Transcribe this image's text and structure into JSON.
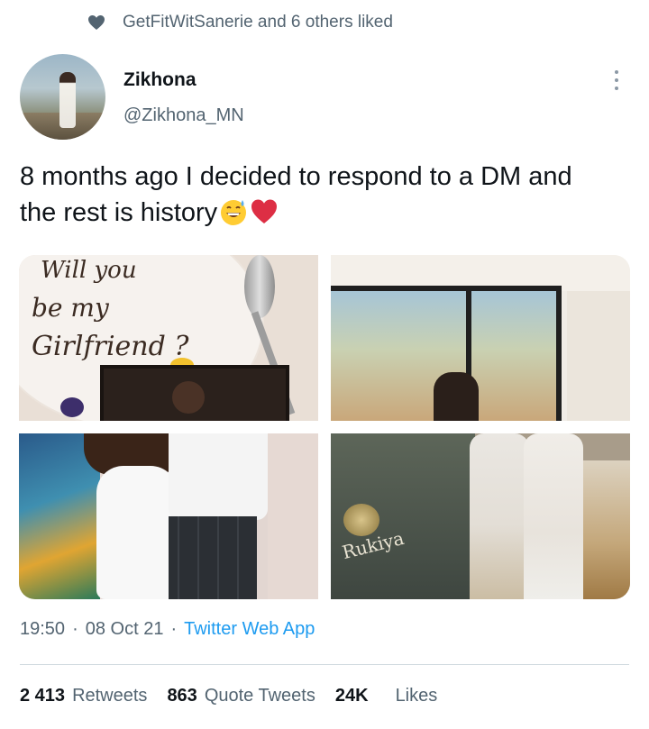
{
  "social_context": {
    "text": "GetFitWitSanerie and 6 others liked"
  },
  "author": {
    "display_name": "Zikhona",
    "handle": "@Zikhona_MN"
  },
  "tweet": {
    "text_line1": "8 months ago I decided to respond to a DM and",
    "text_line2": "the rest is history",
    "emojis": [
      "grinning-sweat-emoji",
      "red-heart-emoji"
    ]
  },
  "media": {
    "photo1": {
      "line1": "Will you",
      "line2": "be my",
      "line3": "Girlfriend ?"
    },
    "photo4": {
      "brand": "Rukiya"
    }
  },
  "meta": {
    "time": "19:50",
    "date": "08 Oct 21",
    "separator": "·",
    "source": "Twitter Web App"
  },
  "stats": {
    "retweets_count": "2 413",
    "retweets_label": "Retweets",
    "quotes_count": "863",
    "quotes_label": "Quote Tweets",
    "likes_count": "24K",
    "likes_label": "Likes"
  },
  "colors": {
    "text_primary": "#0f1419",
    "text_secondary": "#536471",
    "link": "#1d9bf0",
    "heart_icon": "#536471"
  }
}
